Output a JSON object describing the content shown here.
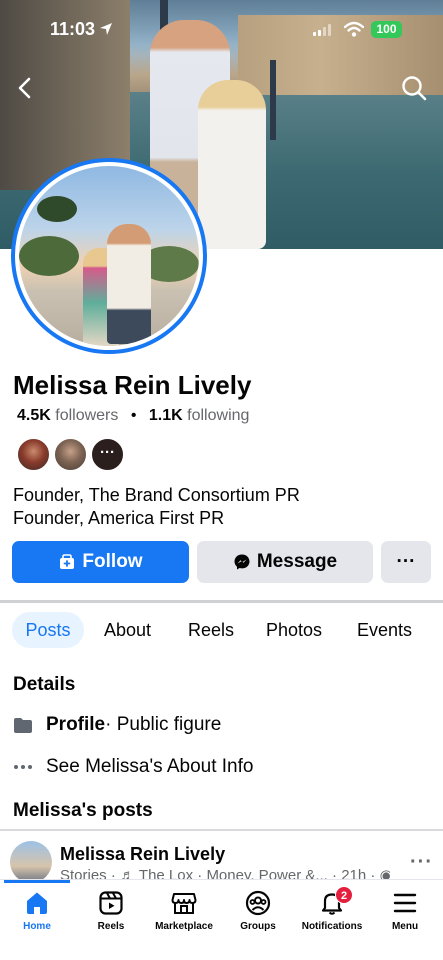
{
  "status_bar": {
    "time": "11:03",
    "battery": "100",
    "battery_color": "#34c759"
  },
  "header": {
    "back_icon": "chevron-left-icon",
    "search_icon": "search-icon"
  },
  "profile": {
    "name": "Melissa Rein Lively",
    "followers_count": "4.5K",
    "followers_label": "followers",
    "following_count": "1.1K",
    "following_label": "following",
    "mutuals_more": "···",
    "bio": [
      "Founder, The Brand Consortium PR",
      "Founder, America First PR"
    ]
  },
  "actions": {
    "follow_label": "Follow",
    "message_label": "Message",
    "more_label": "···",
    "accent": "#1877f2"
  },
  "tabs": [
    {
      "label": "Posts",
      "active": true
    },
    {
      "label": "About"
    },
    {
      "label": "Reels"
    },
    {
      "label": "Photos"
    },
    {
      "label": "Events"
    }
  ],
  "details": {
    "title": "Details",
    "profile_label": "Profile",
    "profile_value": " · Public figure",
    "about_label": "See Melissa's About Info"
  },
  "posts": {
    "title": "Melissa's posts",
    "preview": {
      "author": "Melissa Rein Lively",
      "meta": "Stories · ♬ The Lox · Money, Power &...  · 21h · ◉"
    }
  },
  "bottom_nav": [
    {
      "label": "Home",
      "icon": "home-icon",
      "active": true
    },
    {
      "label": "Reels",
      "icon": "reels-icon"
    },
    {
      "label": "Marketplace",
      "icon": "marketplace-icon"
    },
    {
      "label": "Groups",
      "icon": "groups-icon"
    },
    {
      "label": "Notifications",
      "icon": "bell-icon",
      "badge": "2"
    },
    {
      "label": "Menu",
      "icon": "menu-icon"
    }
  ]
}
